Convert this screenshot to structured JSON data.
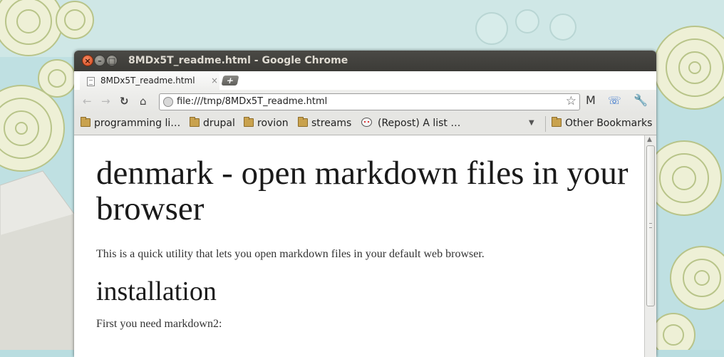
{
  "window": {
    "title": "8MDx5T_readme.html - Google Chrome",
    "close_glyph": "×",
    "minimize_glyph": "–",
    "maximize_glyph": "□"
  },
  "tabs": [
    {
      "label": "8MDx5T_readme.html",
      "close_glyph": "×",
      "icon": "page-icon",
      "active": true
    }
  ],
  "new_tab_glyph": "+",
  "toolbar": {
    "back_glyph": "←",
    "forward_glyph": "→",
    "reload_glyph": "↻",
    "home_glyph": "⌂",
    "url": "file:///tmp/8MDx5T_readme.html",
    "star_glyph": "☆",
    "extensions": [
      {
        "name": "gmail-icon",
        "glyph": "M"
      },
      {
        "name": "phone-icon",
        "glyph": "☏"
      },
      {
        "name": "wrench-icon",
        "glyph": "🔧"
      }
    ]
  },
  "bookmarks": {
    "items": [
      {
        "label": "programming li…",
        "icon": "folder-icon"
      },
      {
        "label": "drupal",
        "icon": "folder-icon"
      },
      {
        "label": "rovion",
        "icon": "folder-icon"
      },
      {
        "label": "streams",
        "icon": "folder-icon"
      },
      {
        "label": "(Repost) A list …",
        "icon": "reddit-icon"
      }
    ],
    "overflow_glyph": "▼",
    "other": {
      "label": "Other Bookmarks",
      "icon": "folder-icon"
    }
  },
  "document": {
    "title": "denmark - open markdown files in your browser",
    "intro": "This is a quick utility that lets you open markdown files in your default web browser.",
    "section_heading": "installation",
    "section_text": "First you need markdown2:"
  },
  "scrollbar": {
    "up_glyph": "▲"
  },
  "colors": {
    "titlebar": "#3c3b37",
    "close_button": "#e0561f",
    "toolbar": "#e6e6e3",
    "wallpaper": "#b9dde0"
  }
}
